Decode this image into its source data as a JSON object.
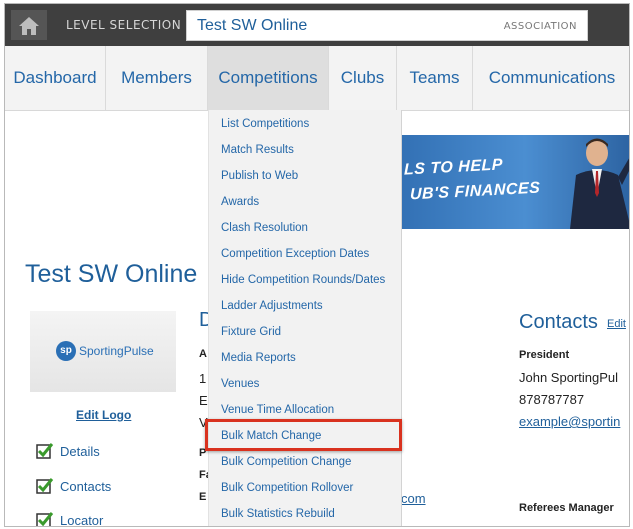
{
  "topbar": {
    "level_selection": "LEVEL SELECTION",
    "current_entity": "Test SW Online",
    "entity_type": "ASSOCIATION"
  },
  "nav": {
    "items": [
      {
        "label": "Dashboard"
      },
      {
        "label": "Members"
      },
      {
        "label": "Competitions",
        "active": true
      },
      {
        "label": "Clubs"
      },
      {
        "label": "Teams"
      },
      {
        "label": "Communications"
      }
    ]
  },
  "dropdown": {
    "items": [
      "List Competitions",
      "Match Results",
      "Publish to Web",
      "Awards",
      "Clash Resolution",
      "Competition Exception Dates",
      "Hide Competition Rounds/Dates",
      "Ladder Adjustments",
      "Fixture Grid",
      "Media Reports",
      "Venues",
      "Venue Time Allocation",
      "Bulk Match Change",
      "Bulk Competition Change",
      "Bulk Competition Rollover",
      "Bulk Statistics Rebuild"
    ],
    "highlighted": "Bulk Match Change"
  },
  "banner": {
    "line1": "LS TO HELP",
    "line2": "UB'S FINANCES"
  },
  "page": {
    "title": "Test SW Online",
    "logo_text": "SportingPulse",
    "logo_mark": "sp",
    "edit_logo": "Edit Logo",
    "checklist": [
      "Details",
      "Contacts",
      "Locator"
    ]
  },
  "details_partial": {
    "heading": "D",
    "lines": [
      "A",
      "1",
      "E",
      "V",
      "P",
      "Fa",
      "E"
    ],
    "link_tail": "com"
  },
  "contacts": {
    "title": "Contacts",
    "edit": "Edit",
    "president_label": "President",
    "president_name": "John SportingPul",
    "president_phone": "878787787",
    "president_email": "example@sportin",
    "referees_label": "Referees Manager"
  },
  "colors": {
    "topbar": "#3f3f3f",
    "link_blue": "#2467a8",
    "highlight_red": "#d9321f",
    "check_green": "#3a9a2c"
  }
}
